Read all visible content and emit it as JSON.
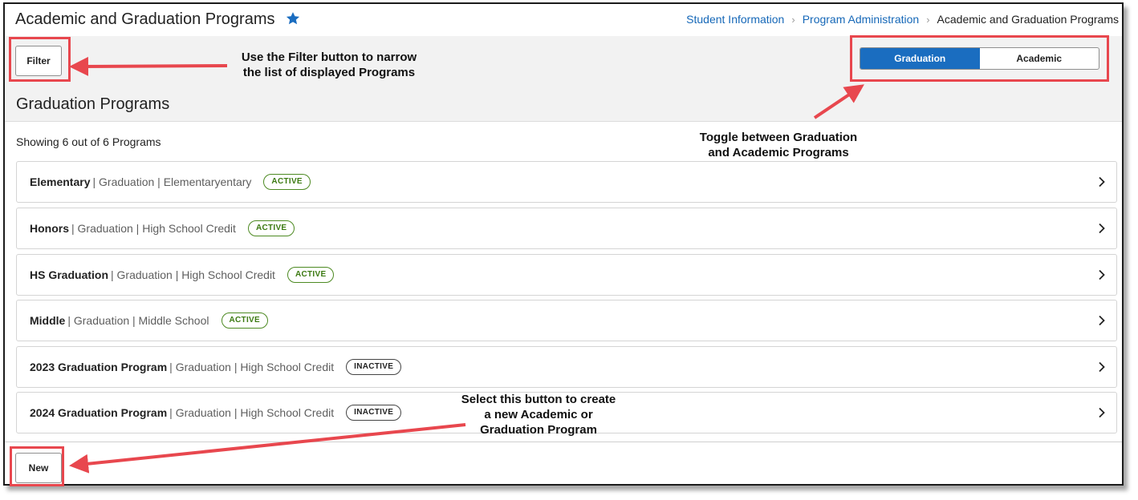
{
  "header": {
    "title": "Academic and Graduation Programs",
    "breadcrumb": [
      "Student Information",
      "Program Administration",
      "Academic and Graduation Programs"
    ]
  },
  "toolbar": {
    "filter_label": "Filter",
    "toggle": {
      "options": [
        "Graduation",
        "Academic"
      ],
      "selected": "Graduation"
    }
  },
  "section": {
    "title": "Graduation Programs",
    "count_text": "Showing 6 out of 6 Programs"
  },
  "programs": [
    {
      "name": "Elementary",
      "meta": "| Graduation | Elementaryentary",
      "status": "ACTIVE"
    },
    {
      "name": "Honors",
      "meta": "| Graduation | High School Credit",
      "status": "ACTIVE"
    },
    {
      "name": "HS Graduation",
      "meta": "| Graduation | High School Credit",
      "status": "ACTIVE"
    },
    {
      "name": "Middle",
      "meta": "| Graduation | Middle School",
      "status": "ACTIVE"
    },
    {
      "name": "2023 Graduation Program",
      "meta": "| Graduation | High School Credit",
      "status": "INACTIVE"
    },
    {
      "name": "2024 Graduation Program",
      "meta": "| Graduation | High School Credit",
      "status": "INACTIVE"
    }
  ],
  "footer": {
    "new_label": "New"
  },
  "annotations": {
    "filter_note": [
      "Use the Filter button to narrow",
      "the list of displayed Programs"
    ],
    "toggle_note": [
      "Toggle between Graduation",
      "and Academic Programs"
    ],
    "new_note": [
      "Select this button to create",
      "a new Academic or",
      "Graduation Program"
    ]
  },
  "colors": {
    "accent": "#1a6dc0",
    "link": "#1668b8",
    "active_badge": "#3c7a12",
    "annotation_red": "#e8474e"
  },
  "icons": {
    "favorite": "star-icon",
    "row_expand": "chevron-right-icon",
    "breadcrumb_sep": "chevron-right-icon"
  }
}
